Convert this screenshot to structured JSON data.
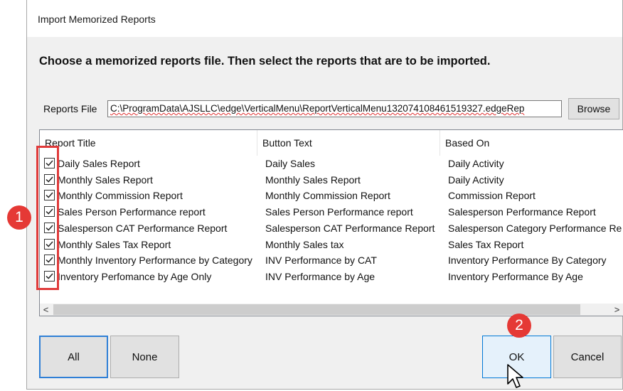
{
  "window": {
    "title": "Import Memorized Reports"
  },
  "instruction": "Choose a memorized reports file.  Then select the reports that are to be imported.",
  "reports_file": {
    "label": "Reports File",
    "value": "C:\\ProgramData\\AJSLLC\\edge\\VerticalMenu\\ReportVerticalMenu132074108461519327.edgeRep",
    "browse_label": "Browse"
  },
  "list": {
    "columns": [
      "Report Title",
      "Button Text",
      "Based On"
    ],
    "rows": [
      {
        "checked": true,
        "title": "Daily Sales Report",
        "button_text": "Daily Sales",
        "based_on": "Daily Activity"
      },
      {
        "checked": true,
        "title": "Monthly Sales Report",
        "button_text": "Monthly Sales Report",
        "based_on": "Daily Activity"
      },
      {
        "checked": true,
        "title": "Monthly Commission Report",
        "button_text": "Monthly Commission Report",
        "based_on": "Commission Report"
      },
      {
        "checked": true,
        "title": "Sales Person Performance report",
        "button_text": "Sales Person Performance report",
        "based_on": "Salesperson Performance Report"
      },
      {
        "checked": true,
        "title": "Salesperson CAT Performance Report",
        "button_text": "Salesperson CAT Performance Report",
        "based_on": "Salesperson Category Performance Re"
      },
      {
        "checked": true,
        "title": "Monthly Sales Tax Report",
        "button_text": "Monthly Sales tax",
        "based_on": "Sales Tax Report"
      },
      {
        "checked": true,
        "title": "Monthly Inventory Performance by Category",
        "button_text": "INV Performance by CAT",
        "based_on": "Inventory Performance By Category"
      },
      {
        "checked": true,
        "title": "Inventory Perfomance by Age Only",
        "button_text": "INV Performance by Age",
        "based_on": "Inventory Performance By Age"
      }
    ],
    "scroll_left": "<",
    "scroll_right": ">"
  },
  "buttons": {
    "all": "All",
    "none": "None",
    "ok": "OK",
    "cancel": "Cancel"
  },
  "annotations": [
    {
      "label": "1",
      "color": "#e53935"
    },
    {
      "label": "2",
      "color": "#e53935"
    }
  ],
  "colors": {
    "highlight": "#e03a3a",
    "default_button_border": "#2f7fd6"
  }
}
